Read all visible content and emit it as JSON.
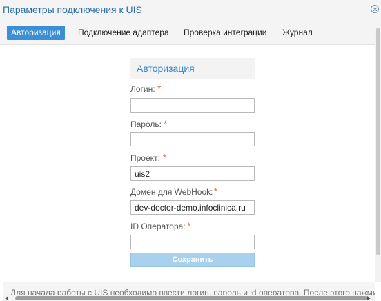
{
  "window": {
    "title": "Параметры подключения к UIS",
    "close_icon": "close-circle-icon"
  },
  "tabs": [
    {
      "label": "Авторизация",
      "active": true
    },
    {
      "label": "Подключение адаптера",
      "active": false
    },
    {
      "label": "Проверка интеграции",
      "active": false
    },
    {
      "label": "Журнал",
      "active": false
    }
  ],
  "form": {
    "title": "Авторизация",
    "required_mark": "*",
    "fields": [
      {
        "label": "Логин:",
        "value": ""
      },
      {
        "label": "Пароль:",
        "value": ""
      },
      {
        "label": "Проект:",
        "value": "uis2"
      },
      {
        "label": "Домен для WebHook:",
        "value": "dev-doctor-demo.infoclinica.ru"
      },
      {
        "label": "ID Оператора:",
        "value": ""
      }
    ],
    "save_label": "Сохранить"
  },
  "info": {
    "text": "Для начала работы с UIS необходимо ввести логин, пароль и id оператора. После этого нажмите кноп"
  },
  "colors": {
    "accent": "#3d8fd5",
    "title": "#2b6ea6",
    "required": "#e8684a",
    "save_button": "#a8d1ee"
  }
}
